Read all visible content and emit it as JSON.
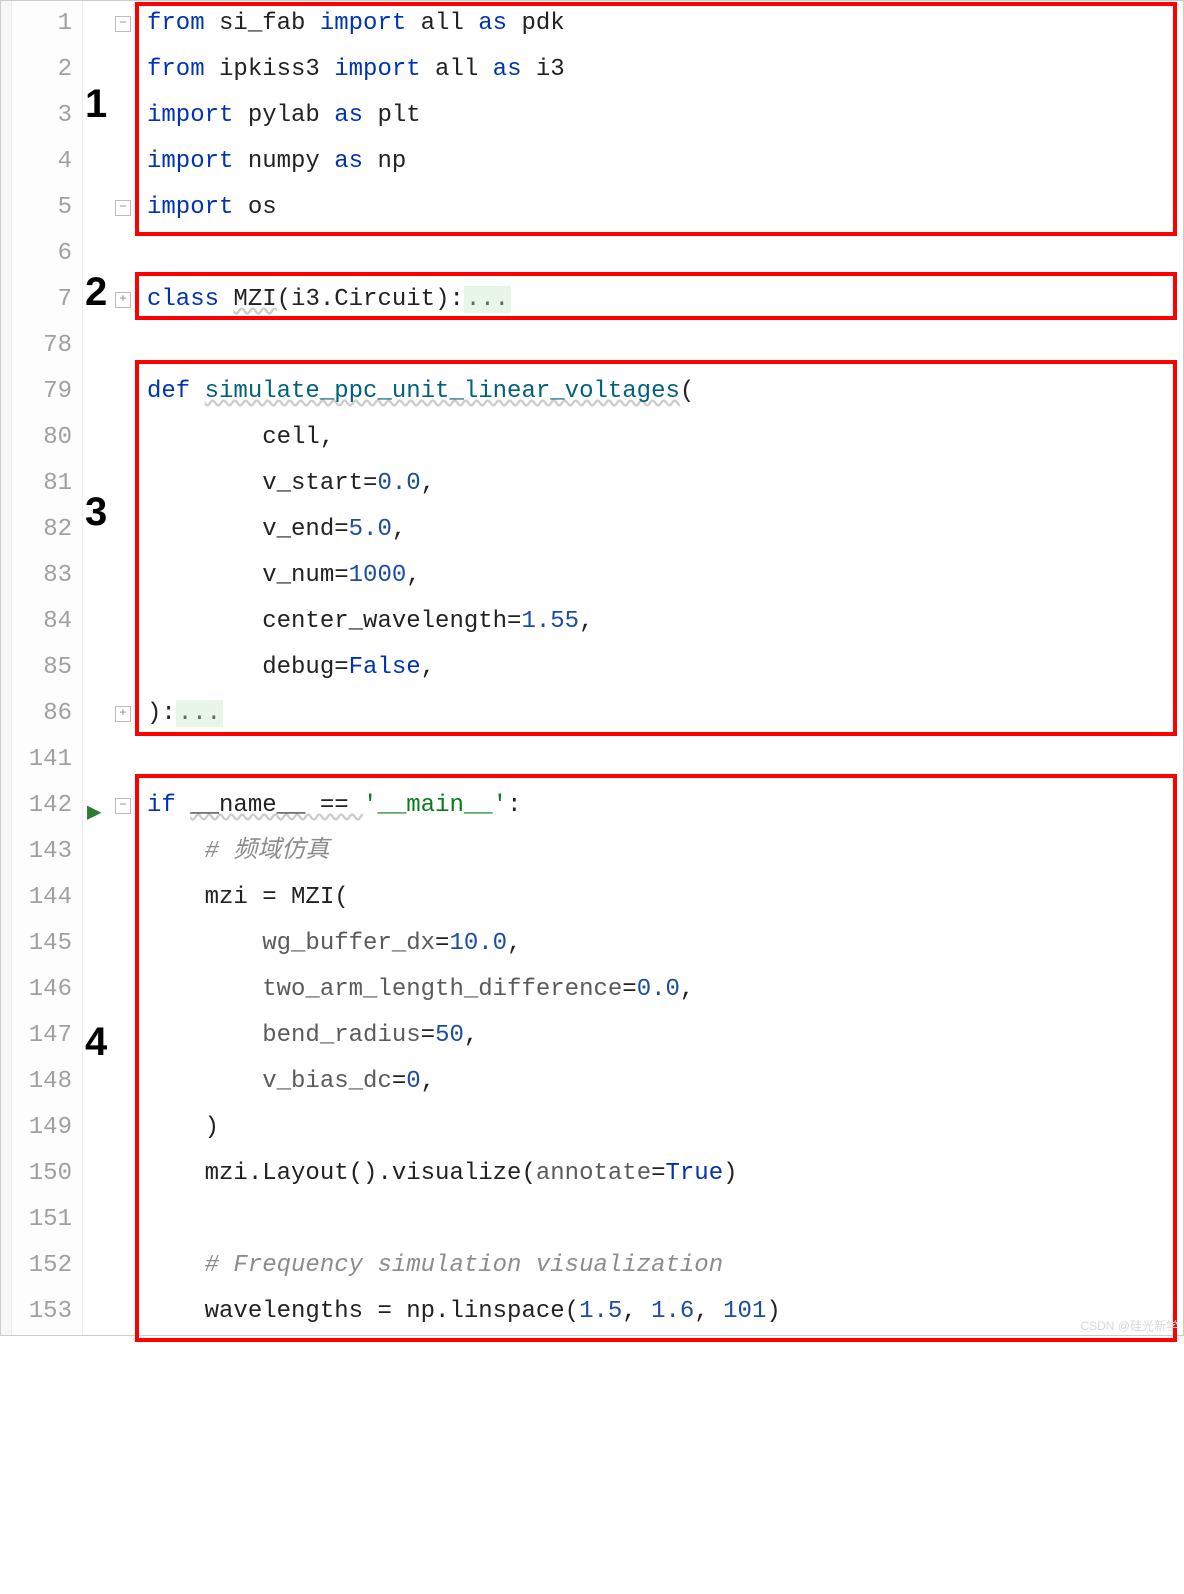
{
  "line_numbers": [
    "1",
    "2",
    "3",
    "4",
    "5",
    "6",
    "7",
    "78",
    "79",
    "80",
    "81",
    "82",
    "83",
    "84",
    "85",
    "86",
    "141",
    "142",
    "143",
    "144",
    "145",
    "146",
    "147",
    "148",
    "149",
    "150",
    "151",
    "152",
    "153"
  ],
  "annotations": {
    "a1": "1",
    "a2": "2",
    "a3": "3",
    "a4": "4"
  },
  "fold": {
    "minus": "−",
    "plus": "+"
  },
  "run_glyph": "▶",
  "tokens": {
    "l1": {
      "t0": "from",
      "t1": " si_fab ",
      "t2": "import",
      "t3": " all ",
      "t4": "as",
      "t5": " pdk"
    },
    "l2": {
      "t0": "from",
      "t1": " ipkiss3 ",
      "t2": "import",
      "t3": " all ",
      "t4": "as",
      "t5": " i3"
    },
    "l3": {
      "t0": "import",
      "t1": " pylab ",
      "t2": "as",
      "t3": " plt"
    },
    "l4": {
      "t0": "import",
      "t1": " numpy ",
      "t2": "as",
      "t3": " np"
    },
    "l5": {
      "t0": "import",
      "t1": " os"
    },
    "l7": {
      "t0": "class ",
      "t1": "MZI",
      "t2": "(i3.Circuit):",
      "t3": "..."
    },
    "l79": {
      "t0": "def ",
      "t1": "simulate_ppc_unit_linear_voltages",
      "t2": "("
    },
    "l80": {
      "t0": "        cell,"
    },
    "l81": {
      "t0": "        v_start=",
      "t1": "0.0",
      "t2": ","
    },
    "l82": {
      "t0": "        v_end=",
      "t1": "5.0",
      "t2": ","
    },
    "l83": {
      "t0": "        v_num=",
      "t1": "1000",
      "t2": ","
    },
    "l84": {
      "t0": "        center_wavelength=",
      "t1": "1.55",
      "t2": ","
    },
    "l85": {
      "t0": "        debug=",
      "t1": "False",
      "t2": ","
    },
    "l86": {
      "t0": "):",
      "t1": "..."
    },
    "l142": {
      "t0": "if ",
      "t1": "__name__ == ",
      "t2": "'__main__'",
      "t3": ":"
    },
    "l143": {
      "t0": "    ",
      "t1": "# 频域仿真"
    },
    "l144": {
      "t0": "    mzi = MZI("
    },
    "l145": {
      "t0": "        ",
      "t1": "wg_buffer_dx",
      "t2": "=",
      "t3": "10.0",
      "t4": ","
    },
    "l146": {
      "t0": "        ",
      "t1": "two_arm_length_difference",
      "t2": "=",
      "t3": "0.0",
      "t4": ","
    },
    "l147": {
      "t0": "        ",
      "t1": "bend_radius",
      "t2": "=",
      "t3": "50",
      "t4": ","
    },
    "l148": {
      "t0": "        ",
      "t1": "v_bias_dc",
      "t2": "=",
      "t3": "0",
      "t4": ","
    },
    "l149": {
      "t0": "    )"
    },
    "l150": {
      "t0": "    mzi.Layout().visualize(",
      "t1": "annotate",
      "t2": "=",
      "t3": "True",
      "t4": ")"
    },
    "l152": {
      "t0": "    ",
      "t1": "# Frequency simulation visualization"
    },
    "l153": {
      "t0": "    wavelengths = np.linspace(",
      "t1": "1.5",
      "t2": ", ",
      "t3": "1.6",
      "t4": ", ",
      "t5": "101",
      "t6": ")"
    }
  },
  "watermark": "CSDN @硅光新学"
}
